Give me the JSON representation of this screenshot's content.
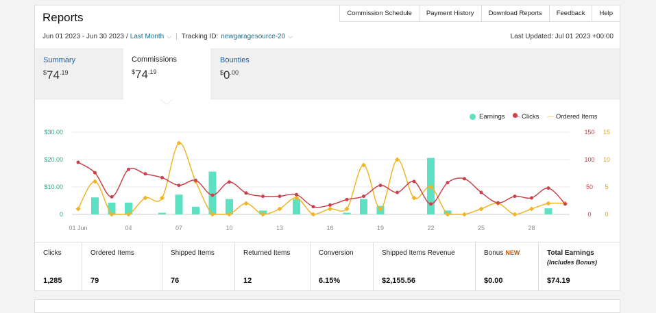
{
  "header": {
    "title": "Reports",
    "nav": [
      "Commission Schedule",
      "Payment History",
      "Download Reports",
      "Feedback",
      "Help"
    ]
  },
  "filters": {
    "date_range": "Jun 01 2023 - Jun 30 2023",
    "date_sep": "/",
    "preset": "Last Month",
    "tracking_label": "Tracking ID:",
    "tracking_id": "newgaragesource-20",
    "last_updated": "Last Updated: Jul 01 2023 +00:00"
  },
  "tabs": [
    {
      "label": "Summary",
      "currency": "$",
      "whole": "74",
      "cents": ".19"
    },
    {
      "label": "Commissions",
      "currency": "$",
      "whole": "74",
      "cents": ".19"
    },
    {
      "label": "Bounties",
      "currency": "$",
      "whole": "0",
      "cents": ".00"
    }
  ],
  "colors": {
    "earnings": "#5ee0c3",
    "clicks": "#c9424b",
    "ordered": "#f0b429",
    "accent": "#1a6e8e"
  },
  "chart_data": {
    "type": "bar+line",
    "legend": [
      "Earnings",
      "Clicks",
      "Ordered Items"
    ],
    "x_tick_labels": [
      "01 Jun",
      "04",
      "07",
      "10",
      "13",
      "16",
      "19",
      "22",
      "25",
      "28"
    ],
    "x": [
      1,
      2,
      3,
      4,
      5,
      6,
      7,
      8,
      9,
      10,
      11,
      12,
      13,
      14,
      15,
      16,
      17,
      18,
      19,
      20,
      21,
      22,
      23,
      24,
      25,
      26,
      27,
      28,
      29,
      30
    ],
    "y_left_ticks": [
      "$30.00",
      "$20.00",
      "$10.00",
      "0"
    ],
    "y_left_range": [
      0,
      30
    ],
    "y_clicks_ticks": [
      "150",
      "100",
      "50",
      "0"
    ],
    "y_clicks_range": [
      0,
      150
    ],
    "y_items_ticks": [
      "15",
      "10",
      "5",
      "0"
    ],
    "y_items_range": [
      0,
      15
    ],
    "series": [
      {
        "name": "Earnings",
        "axis": "left",
        "values": [
          0,
          6.2,
          4.3,
          4.3,
          0,
          0.6,
          7.2,
          2.8,
          15.6,
          5.6,
          0,
          1.4,
          0,
          5.6,
          0,
          0,
          0.6,
          5.6,
          3.1,
          0,
          0,
          20.6,
          1.4,
          0,
          0,
          0,
          0,
          0,
          2.2,
          0
        ]
      },
      {
        "name": "Clicks",
        "axis": "clicks",
        "values": [
          95,
          76,
          32,
          82,
          74,
          67,
          53,
          62,
          35,
          59,
          39,
          33,
          33,
          36,
          14,
          17,
          27,
          33,
          53,
          40,
          60,
          19,
          58,
          65,
          40,
          21,
          33,
          30,
          48,
          19
        ]
      },
      {
        "name": "Ordered Items",
        "axis": "items",
        "values": [
          1,
          6,
          0,
          0,
          3,
          3,
          13,
          6,
          0,
          0,
          2,
          0,
          1,
          3,
          0,
          1,
          1,
          9,
          1,
          10,
          3,
          5,
          0,
          0,
          1,
          2,
          0,
          1,
          2,
          2
        ]
      }
    ]
  },
  "stats": [
    {
      "label": "Clicks",
      "value": "1,285"
    },
    {
      "label": "Ordered Items",
      "value": "79"
    },
    {
      "label": "Shipped Items",
      "value": "76"
    },
    {
      "label": "Returned Items",
      "value": "12"
    },
    {
      "label": "Conversion",
      "value": "6.15%"
    },
    {
      "label": "Shipped Items Revenue",
      "value": "$2,155.56"
    },
    {
      "label": "Bonus",
      "badge": "NEW",
      "value": "$0.00"
    },
    {
      "label": "Total Earnings",
      "sub": "(Includes Bonus)",
      "value": "$74.19"
    }
  ]
}
